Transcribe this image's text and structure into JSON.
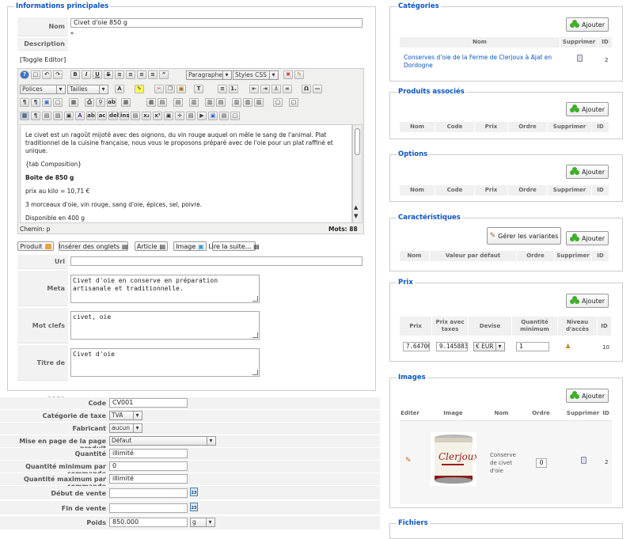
{
  "info": {
    "legend": "Informations principales",
    "labels": {
      "nom": "Nom",
      "description": "Description",
      "url": "Url",
      "meta": "Meta description",
      "motclefs": "Mot clefs",
      "titre": "Titre de page"
    },
    "nom_value": "Civet d'oie 850 g",
    "toggle_editor": "[Toggle Editor]",
    "format_select": "Paragraphe",
    "styles_select": "Styles CSS",
    "fonts_select": "Polices",
    "sizes_select": "Tailles",
    "editor_lines": [
      "Le civet est un ragoût mijoté avec des oignons, du vin rouge auquel on mêle le sang de l'animal. Plat traditionnel de la cuisine française, nous vous le proposons préparé avec de l'oie pour un plat raffiné et unique.",
      "{tab Composition}",
      "Boite de 850 g",
      "prix au kilo = 10,71 €",
      "3 morceaux d'oie, vin rouge, sang d'oie, épices, sel, poivre.",
      "Disponible en 400 g"
    ],
    "path_label": "Chemin: p",
    "word_count": "Mots: 88",
    "editor_buttons": [
      "Produit",
      "Insérer des onglets",
      "Article",
      "Image",
      "Lire la suite..."
    ],
    "url_value": "",
    "meta_value": "Civet d'oie en conserve en préparation\nartisanale et traditionnelle.",
    "motclefs_value": "civet, oie",
    "titre_value": "Civet d'oie"
  },
  "details": {
    "code_label": "Code",
    "code_value": "CV001",
    "taxe_label": "Catégorie de taxe",
    "taxe_value": "TVA",
    "fabricant_label": "Fabricant",
    "fabricant_value": "aucun",
    "layout_label": "Mise en page de la page produit",
    "layout_value": "Défaut",
    "quantite_label": "Quantité",
    "quantite_value": "illimité",
    "qmin_label": "Quantité minimum par commande",
    "qmin_value": "0",
    "qmax_label": "Quantité maximum par commande",
    "qmax_value": "illimité",
    "debut_label": "Début de vente",
    "debut_value": "",
    "fin_label": "Fin de vente",
    "fin_value": "",
    "poids_label": "Poids",
    "poids_value": "850.000",
    "poids_unit": "g"
  },
  "categories": {
    "legend": "Catégories",
    "add": "Ajouter",
    "headers": [
      "Nom",
      "Supprimer",
      "ID"
    ],
    "rows": [
      {
        "nom": "Conserves d'oie de la Ferme de Clerjoux à Ajat en Dordogne",
        "id": "2"
      }
    ]
  },
  "produits_associes": {
    "legend": "Produits associés",
    "add": "Ajouter",
    "headers": [
      "Nom",
      "Code",
      "Prix",
      "Ordre",
      "Supprimer",
      "ID"
    ]
  },
  "options": {
    "legend": "Options",
    "add": "Ajouter",
    "headers": [
      "Nom",
      "Code",
      "Prix",
      "Ordre",
      "Supprimer",
      "ID"
    ]
  },
  "caracteristiques": {
    "legend": "Caractéristiques",
    "variants": "Gérer les variantes",
    "add": "Ajouter",
    "headers": [
      "Nom",
      "Valeur par défaut",
      "Ordre",
      "Supprimer",
      "ID"
    ]
  },
  "prix": {
    "legend": "Prix",
    "add": "Ajouter",
    "headers": [
      "Prix",
      "Prix avec taxes",
      "Devise",
      "Quantité minimum",
      "Niveau d'accès",
      "ID"
    ],
    "row": {
      "prix": "7.64706",
      "ttc": "9.1458837",
      "devise": "€ EUR",
      "quantite": "1",
      "id": "10"
    }
  },
  "images": {
    "legend": "Images",
    "add": "Ajouter",
    "headers": [
      "Editer",
      "Image",
      "Nom",
      "Ordre",
      "Supprimer",
      "ID"
    ],
    "row": {
      "nom": "Conserve de civet d'oie",
      "ordre": "0",
      "id": "2",
      "brand": "Clerjoux"
    }
  },
  "fichiers": {
    "legend": "Fichiers"
  }
}
